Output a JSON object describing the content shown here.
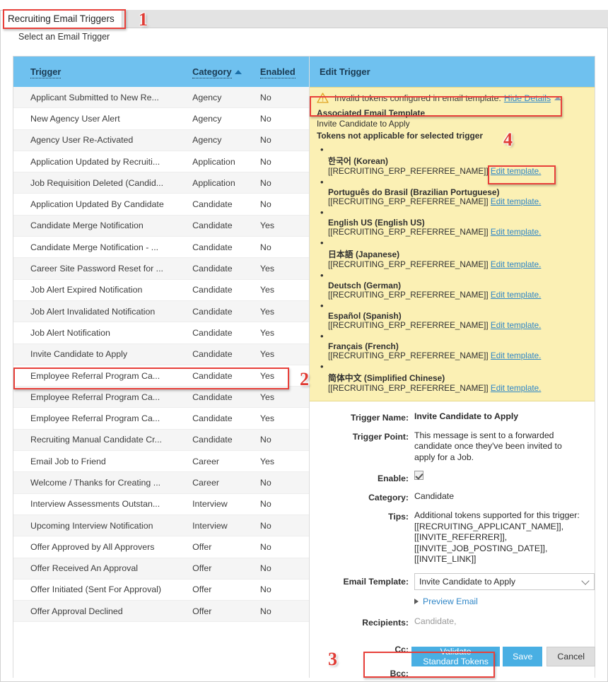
{
  "tab": {
    "label": "Recruiting Email Triggers"
  },
  "subtitle": "Select an Email Trigger",
  "list": {
    "columns": {
      "trigger": "Trigger",
      "category": "Category",
      "enabled": "Enabled"
    },
    "sort": {
      "column": "Category",
      "direction": "asc"
    },
    "rows": [
      {
        "trigger": "Applicant Submitted to New Re...",
        "category": "Agency",
        "enabled": "No"
      },
      {
        "trigger": "New Agency User Alert",
        "category": "Agency",
        "enabled": "No"
      },
      {
        "trigger": "Agency User Re-Activated",
        "category": "Agency",
        "enabled": "No"
      },
      {
        "trigger": "Application Updated by Recruiti...",
        "category": "Application",
        "enabled": "No"
      },
      {
        "trigger": "Job Requisition Deleted (Candid...",
        "category": "Application",
        "enabled": "No"
      },
      {
        "trigger": "Application Updated By Candidate",
        "category": "Candidate",
        "enabled": "No"
      },
      {
        "trigger": "Candidate Merge Notification",
        "category": "Candidate",
        "enabled": "Yes"
      },
      {
        "trigger": "Candidate Merge Notification - ...",
        "category": "Candidate",
        "enabled": "No"
      },
      {
        "trigger": "Career Site Password Reset for ...",
        "category": "Candidate",
        "enabled": "Yes"
      },
      {
        "trigger": "Job Alert Expired Notification",
        "category": "Candidate",
        "enabled": "Yes"
      },
      {
        "trigger": "Job Alert Invalidated Notification",
        "category": "Candidate",
        "enabled": "Yes"
      },
      {
        "trigger": "Job Alert Notification",
        "category": "Candidate",
        "enabled": "Yes"
      },
      {
        "trigger": "Invite Candidate to Apply",
        "category": "Candidate",
        "enabled": "Yes"
      },
      {
        "trigger": "Employee Referral Program Ca...",
        "category": "Candidate",
        "enabled": "Yes"
      },
      {
        "trigger": "Employee Referral Program Ca...",
        "category": "Candidate",
        "enabled": "Yes"
      },
      {
        "trigger": "Employee Referral Program Ca...",
        "category": "Candidate",
        "enabled": "Yes"
      },
      {
        "trigger": "Recruiting Manual Candidate Cr...",
        "category": "Candidate",
        "enabled": "No"
      },
      {
        "trigger": "Email Job to Friend",
        "category": "Career",
        "enabled": "Yes"
      },
      {
        "trigger": "Welcome / Thanks for Creating ...",
        "category": "Career",
        "enabled": "No"
      },
      {
        "trigger": "Interview Assessments Outstan...",
        "category": "Interview",
        "enabled": "No"
      },
      {
        "trigger": "Upcoming Interview Notification",
        "category": "Interview",
        "enabled": "No"
      },
      {
        "trigger": "Offer Approved by All Approvers",
        "category": "Offer",
        "enabled": "No"
      },
      {
        "trigger": "Offer Received An Approval",
        "category": "Offer",
        "enabled": "No"
      },
      {
        "trigger": "Offer Initiated (Sent For Approval)",
        "category": "Offer",
        "enabled": "No"
      },
      {
        "trigger": "Offer Approval Declined",
        "category": "Offer",
        "enabled": "No"
      }
    ]
  },
  "edit": {
    "header": "Edit Trigger",
    "warning": {
      "message": "Invalid tokens configured in email template.",
      "toggle_link": "Hide Details",
      "associated_label": "Associated Email Template",
      "associated_value": "Invite Candidate to Apply",
      "tokens_heading": "Tokens not applicable for selected trigger",
      "edit_link": "Edit template.",
      "languages": [
        {
          "name": "한국어 (Korean)",
          "token": "[[RECRUITING_ERP_REFERREE_NAME]]"
        },
        {
          "name": "Português do Brasil (Brazilian Portuguese)",
          "token": "[[RECRUITING_ERP_REFERREE_NAME]]"
        },
        {
          "name": "English US (English US)",
          "token": "[[RECRUITING_ERP_REFERREE_NAME]]"
        },
        {
          "name": "日本語 (Japanese)",
          "token": "[[RECRUITING_ERP_REFERREE_NAME]]"
        },
        {
          "name": "Deutsch (German)",
          "token": "[[RECRUITING_ERP_REFERREE_NAME]]"
        },
        {
          "name": "Español (Spanish)",
          "token": "[[RECRUITING_ERP_REFERREE_NAME]]"
        },
        {
          "name": "Français (French)",
          "token": "[[RECRUITING_ERP_REFERREE_NAME]]"
        },
        {
          "name": "简体中文 (Simplified Chinese)",
          "token": "[[RECRUITING_ERP_REFERREE_NAME]]"
        }
      ]
    },
    "form": {
      "trigger_name_label": "Trigger Name:",
      "trigger_name_value": "Invite Candidate to Apply",
      "trigger_point_label": "Trigger Point:",
      "trigger_point_value": "This message is sent to a forwarded candidate once they've been invited to apply for a Job.",
      "enable_label": "Enable:",
      "enable_checked": true,
      "category_label": "Category:",
      "category_value": "Candidate",
      "tips_label": "Tips:",
      "tips_value": "Additional tokens supported for this trigger: [[RECRUITING_APPLICANT_NAME]], [[INVITE_REFERRER]], [[INVITE_JOB_POSTING_DATE]], [[INVITE_LINK]]",
      "email_template_label": "Email Template:",
      "email_template_value": "Invite Candidate to Apply",
      "preview_link": "Preview Email",
      "recipients_label": "Recipients:",
      "recipients_value": "Candidate,",
      "cc_label": "Cc:",
      "cc_value": "",
      "bcc_label": "Bcc:",
      "bcc_value": ""
    },
    "buttons": {
      "validate": "Validate Standard Tokens",
      "save": "Save",
      "cancel": "Cancel"
    }
  },
  "annotations": [
    {
      "number": "1"
    },
    {
      "number": "2"
    },
    {
      "number": "3"
    },
    {
      "number": "4"
    }
  ],
  "colors": {
    "header_blue": "#6fc1ef",
    "warning_bg": "#fbf0b4",
    "link_blue": "#2f86c7",
    "annotation_red": "#e8403a",
    "primary_button": "#49afe3"
  }
}
